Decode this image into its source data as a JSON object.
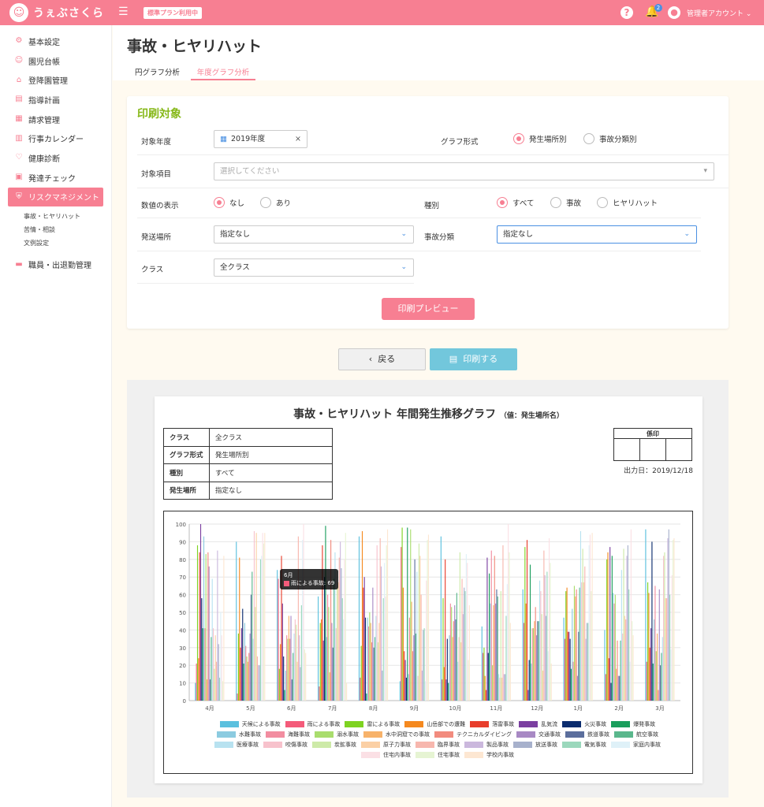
{
  "app": {
    "name": "うぇぶさくら",
    "plan_badge": "標準プラン利用中",
    "notif_count": "2",
    "user_label": "管理者アカウント"
  },
  "sidebar": {
    "items": [
      {
        "label": "基本設定",
        "icon": "gear-icon",
        "glyph": "⚙"
      },
      {
        "label": "園児台帳",
        "icon": "child-icon",
        "glyph": "☺"
      },
      {
        "label": "登降園管理",
        "icon": "house-icon",
        "glyph": "⌂"
      },
      {
        "label": "指導計画",
        "icon": "notebook-icon",
        "glyph": "▤"
      },
      {
        "label": "請求管理",
        "icon": "calculator-icon",
        "glyph": "▦"
      },
      {
        "label": "行事カレンダー",
        "icon": "calendar-icon",
        "glyph": "▥"
      },
      {
        "label": "健康診断",
        "icon": "stethoscope-icon",
        "glyph": "♡"
      },
      {
        "label": "発達チェック",
        "icon": "clipboard-icon",
        "glyph": "▣"
      },
      {
        "label": "リスクマネジメント",
        "icon": "shield-icon",
        "glyph": "⛨"
      }
    ],
    "sub_items": [
      "事故・ヒヤリハット",
      "苦情・相談",
      "文例設定"
    ],
    "last_item": {
      "label": "職員・出退勤管理",
      "icon": "briefcase-icon",
      "glyph": "▬"
    }
  },
  "page": {
    "title": "事故・ヒヤリハット",
    "tabs": [
      "円グラフ分析",
      "年度グラフ分析"
    ]
  },
  "form": {
    "title": "印刷対象",
    "year_label": "対象年度",
    "year_value": "2019年度",
    "graph_type_label": "グラフ形式",
    "graph_type_options": [
      "発生場所別",
      "事故分類別"
    ],
    "target_label": "対象項目",
    "target_placeholder": "選択してください",
    "show_value_label": "数値の表示",
    "show_value_options": [
      "なし",
      "あり"
    ],
    "kind_label": "種別",
    "kind_options": [
      "すべて",
      "事故",
      "ヒヤリハット"
    ],
    "place_label": "発送場所",
    "place_value": "指定なし",
    "category_label": "事故分類",
    "category_value": "指定なし",
    "class_label": "クラス",
    "class_value": "全クラス",
    "preview_button": "印刷プレビュー"
  },
  "actions": {
    "back": "戻る",
    "print": "印刷する"
  },
  "report": {
    "title": "事故・ヒヤリハット 年間発生推移グラフ",
    "title_note": "（値：発生場所名）",
    "info": [
      {
        "k": "クラス",
        "v": "全クラス"
      },
      {
        "k": "グラフ形式",
        "v": "発生場所別"
      },
      {
        "k": "種別",
        "v": "すべて"
      },
      {
        "k": "発生場所",
        "v": "指定なし"
      }
    ],
    "seal_label": "係印",
    "output_date": "出力日：2019/12/18",
    "tooltip": {
      "month": "6月",
      "text": "雨による事故: 69"
    }
  },
  "chart_data": {
    "type": "bar",
    "ylim": [
      0,
      100
    ],
    "yticks": [
      0,
      10,
      20,
      30,
      40,
      50,
      60,
      70,
      80,
      90,
      100
    ],
    "categories": [
      "4月",
      "5月",
      "6月",
      "7月",
      "8月",
      "9月",
      "10月",
      "11月",
      "12月",
      "1月",
      "2月",
      "3月"
    ],
    "grid": true,
    "legend_position": "bottom",
    "series": [
      {
        "name": "天候による事故",
        "color": "#5bc0de",
        "values": [
          10,
          90,
          74,
          59,
          93,
          11,
          93,
          42,
          63,
          47,
          40,
          97
        ]
      },
      {
        "name": "雨による事故",
        "color": "#f45b7a",
        "values": [
          21,
          4,
          69,
          8,
          13,
          87,
          12,
          27,
          44,
          35,
          15,
          22
        ]
      },
      {
        "name": "雷による事故",
        "color": "#7ed321",
        "values": [
          88,
          38,
          18,
          44,
          31,
          98,
          58,
          30,
          87,
          62,
          80,
          67
        ]
      },
      {
        "name": "山岳部での遭難",
        "color": "#f5891f",
        "values": [
          24,
          81,
          32,
          46,
          96,
          64,
          19,
          14,
          55,
          64,
          84,
          61
        ]
      },
      {
        "name": "落雷事故",
        "color": "#e83e2c",
        "values": [
          84,
          30,
          82,
          88,
          64,
          28,
          80,
          6,
          91,
          39,
          24,
          30
        ]
      },
      {
        "name": "乱気流",
        "color": "#7b3fa0",
        "values": [
          100,
          41,
          55,
          34,
          70,
          23,
          12,
          81,
          6,
          39,
          87,
          41
        ]
      },
      {
        "name": "火災事故",
        "color": "#0b2c6e",
        "values": [
          58,
          52,
          25,
          70,
          47,
          13,
          35,
          27,
          23,
          35,
          10,
          90
        ]
      },
      {
        "name": "爆発事故",
        "color": "#1a9e5c",
        "values": [
          41,
          21,
          6,
          99,
          4,
          98,
          10,
          72,
          77,
          18,
          82,
          21
        ]
      },
      {
        "name": "水難事故",
        "color": "#8ccbe0",
        "values": [
          93,
          44,
          17,
          36,
          47,
          15,
          37,
          55,
          21,
          52,
          61,
          46
        ]
      },
      {
        "name": "海難事故",
        "color": "#f28da0",
        "values": [
          41,
          31,
          37,
          60,
          42,
          47,
          55,
          85,
          41,
          22,
          55,
          65
        ]
      },
      {
        "name": "溺水事故",
        "color": "#a9dd6d",
        "values": [
          83,
          25,
          35,
          53,
          50,
          97,
          53,
          20,
          41,
          65,
          60,
          28
        ]
      },
      {
        "name": "水中洞窟での事故",
        "color": "#f7b26a",
        "values": [
          12,
          22,
          48,
          16,
          44,
          56,
          36,
          54,
          45,
          59,
          18,
          38
        ]
      },
      {
        "name": "テクニカルダイビング",
        "color": "#f28b7e",
        "values": [
          84,
          27,
          35,
          91,
          33,
          28,
          45,
          82,
          53,
          63,
          34,
          6
        ]
      },
      {
        "name": "交通事故",
        "color": "#a889c4",
        "values": [
          76,
          38,
          48,
          44,
          64,
          37,
          54,
          55,
          37,
          14,
          14,
          63
        ]
      },
      {
        "name": "鉄道事故",
        "color": "#5b6e9c",
        "values": [
          12,
          60,
          12,
          30,
          30,
          80,
          46,
          63,
          45,
          39,
          14,
          20
        ]
      },
      {
        "name": "航空事故",
        "color": "#5ab78c",
        "values": [
          36,
          73,
          27,
          69,
          36,
          38,
          61,
          59,
          45,
          64,
          34,
          27
        ]
      },
      {
        "name": "医療事故",
        "color": "#b8e2f0",
        "values": [
          69,
          35,
          38,
          84,
          48,
          73,
          22,
          15,
          68,
          96,
          74,
          36
        ]
      },
      {
        "name": "咬傷事故",
        "color": "#f7c2cc",
        "values": [
          41,
          96,
          46,
          41,
          88,
          14,
          36,
          13,
          62,
          67,
          38,
          82
        ]
      },
      {
        "name": "炭鉱事故",
        "color": "#cdeaa8",
        "values": [
          18,
          53,
          43,
          64,
          33,
          89,
          84,
          62,
          49,
          86,
          86,
          84
        ]
      },
      {
        "name": "原子力事故",
        "color": "#fbd0a5",
        "values": [
          37,
          95,
          22,
          67,
          44,
          82,
          33,
          13,
          17,
          67,
          48,
          58
        ]
      },
      {
        "name": "臨界事故",
        "color": "#f7b7ae",
        "values": [
          22,
          25,
          93,
          81,
          92,
          60,
          69,
          88,
          85,
          76,
          46,
          58
        ]
      },
      {
        "name": "製品事故",
        "color": "#cbb8dd",
        "values": [
          85,
          20,
          37,
          90,
          76,
          17,
          49,
          15,
          71,
          35,
          82,
          92
        ]
      },
      {
        "name": "放送事故",
        "color": "#a7b1cc",
        "values": [
          32,
          20,
          19,
          75,
          17,
          40,
          64,
          15,
          48,
          44,
          88,
          97
        ]
      },
      {
        "name": "電気事故",
        "color": "#9bd8bc",
        "values": [
          13,
          80,
          54,
          58,
          58,
          41,
          62,
          48,
          73,
          44,
          63,
          60
        ]
      },
      {
        "name": "家庭内事故",
        "color": "#dff1f8",
        "values": [
          50,
          82,
          91,
          46,
          78,
          11,
          83,
          66,
          28,
          88,
          22,
          29
        ]
      },
      {
        "name": "住宅内事故",
        "color": "#fbe0e5",
        "values": [
          37,
          95,
          100,
          80,
          59,
          68,
          78,
          100,
          92,
          94,
          97,
          71
        ]
      },
      {
        "name": "住宅事故",
        "color": "#e6f4d3",
        "values": [
          11,
          89,
          29,
          95,
          88,
          91,
          23,
          84,
          78,
          62,
          45,
          91
        ]
      },
      {
        "name": "学校内事故",
        "color": "#fde7d2",
        "values": [
          82,
          95,
          27,
          10,
          97,
          94,
          54,
          44,
          21,
          95,
          37,
          92
        ]
      }
    ]
  }
}
